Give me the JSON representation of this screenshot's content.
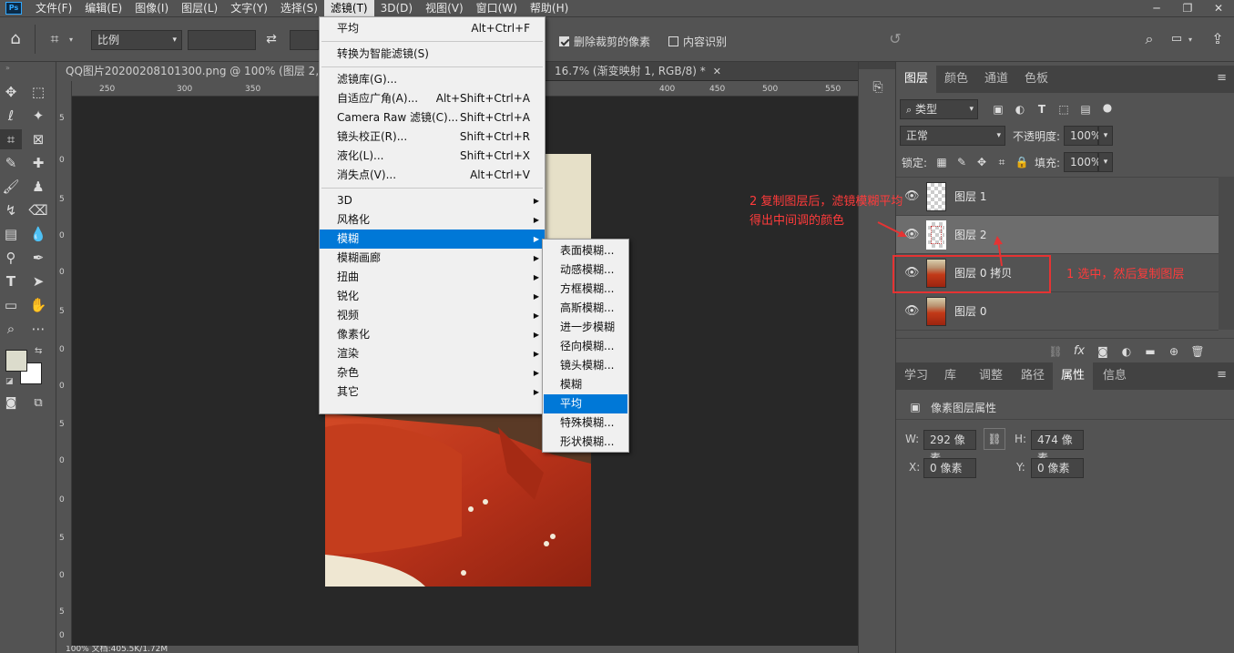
{
  "menubar": {
    "items": [
      "文件(F)",
      "编辑(E)",
      "图像(I)",
      "图层(L)",
      "文字(Y)",
      "选择(S)",
      "滤镜(T)",
      "3D(D)",
      "视图(V)",
      "窗口(W)",
      "帮助(H)"
    ],
    "active": "滤镜(T)",
    "window_controls": [
      "─",
      "❐",
      "✕"
    ]
  },
  "options": {
    "ratio_select": "比例",
    "delete_cropped_label": "删除裁剪的像素",
    "delete_cropped_checked": true,
    "content_aware_label": "内容识别",
    "content_aware_checked": false
  },
  "document": {
    "tab1": "QQ图片20200208101300.png @ 100% (图层 2, RG",
    "tab2": "16.7% (渐变映射 1, RGB/8) *",
    "ruler_h_ticks": [
      "250",
      "300",
      "350",
      "400",
      "450",
      "500",
      "550"
    ],
    "ruler_v_ticks": [
      "5",
      "0",
      "5",
      "0",
      "0",
      "5",
      "0",
      "0",
      "5",
      "0",
      "0",
      "5",
      "0",
      "5",
      "0"
    ],
    "status": "100%          文档:405.5K/1.72M"
  },
  "filter_menu": {
    "items": [
      {
        "label": "平均",
        "shortcut": "Alt+Ctrl+F"
      },
      {
        "sep": true
      },
      {
        "label": "转换为智能滤镜(S)"
      },
      {
        "sep": true
      },
      {
        "label": "滤镜库(G)..."
      },
      {
        "label": "自适应广角(A)...",
        "shortcut": "Alt+Shift+Ctrl+A"
      },
      {
        "label": "Camera Raw 滤镜(C)...",
        "shortcut": "Shift+Ctrl+A"
      },
      {
        "label": "镜头校正(R)...",
        "shortcut": "Shift+Ctrl+R"
      },
      {
        "label": "液化(L)...",
        "shortcut": "Shift+Ctrl+X"
      },
      {
        "label": "消失点(V)...",
        "shortcut": "Alt+Ctrl+V"
      },
      {
        "sep": true
      },
      {
        "label": "3D",
        "submenu": true
      },
      {
        "label": "风格化",
        "submenu": true
      },
      {
        "label": "模糊",
        "submenu": true,
        "highlight": true
      },
      {
        "label": "模糊画廊",
        "submenu": true
      },
      {
        "label": "扭曲",
        "submenu": true
      },
      {
        "label": "锐化",
        "submenu": true
      },
      {
        "label": "视频",
        "submenu": true
      },
      {
        "label": "像素化",
        "submenu": true
      },
      {
        "label": "渲染",
        "submenu": true
      },
      {
        "label": "杂色",
        "submenu": true
      },
      {
        "label": "其它",
        "submenu": true
      }
    ]
  },
  "blur_menu": {
    "items": [
      "表面模糊...",
      "动感模糊...",
      "方框模糊...",
      "高斯模糊...",
      "进一步模糊",
      "径向模糊...",
      "镜头模糊...",
      "模糊",
      "平均",
      "特殊模糊...",
      "形状模糊..."
    ],
    "highlight": "平均"
  },
  "layers_panel": {
    "tabs": [
      "图层",
      "颜色",
      "通道",
      "色板"
    ],
    "active_tab": "图层",
    "kind_filter": "类型",
    "blend_mode": "正常",
    "opacity_label": "不透明度:",
    "opacity": "100%",
    "lock_label": "锁定:",
    "fill_label": "填充:",
    "fill": "100%",
    "layers": [
      {
        "name": "图层 1",
        "thumb": "transparent",
        "selected": false
      },
      {
        "name": "图层 2",
        "thumb": "transparent-sketch",
        "selected": true
      },
      {
        "name": "图层 0 拷贝",
        "thumb": "photo",
        "selected": false
      },
      {
        "name": "图层 0",
        "thumb": "photo",
        "selected": false
      }
    ]
  },
  "props_panel": {
    "tabs": [
      "学习",
      "库",
      "调整",
      "路径",
      "属性",
      "信息"
    ],
    "active_tab": "属性",
    "title": "像素图层属性",
    "w_label": "W:",
    "w": "292 像素",
    "h_label": "H:",
    "h": "474 像素",
    "x_label": "X:",
    "x": "0 像素",
    "y_label": "Y:",
    "y": "0 像素"
  },
  "annotations": {
    "note2_line1": "2 复制图层后，滤镜模糊平均",
    "note2_line2": "得出中间调的颜色",
    "note1": "1 选中，然后复制图层"
  },
  "colors": {
    "annotation": "#ff3b3b",
    "menu_highlight": "#0078d7",
    "foreground": "#dcdccc"
  }
}
